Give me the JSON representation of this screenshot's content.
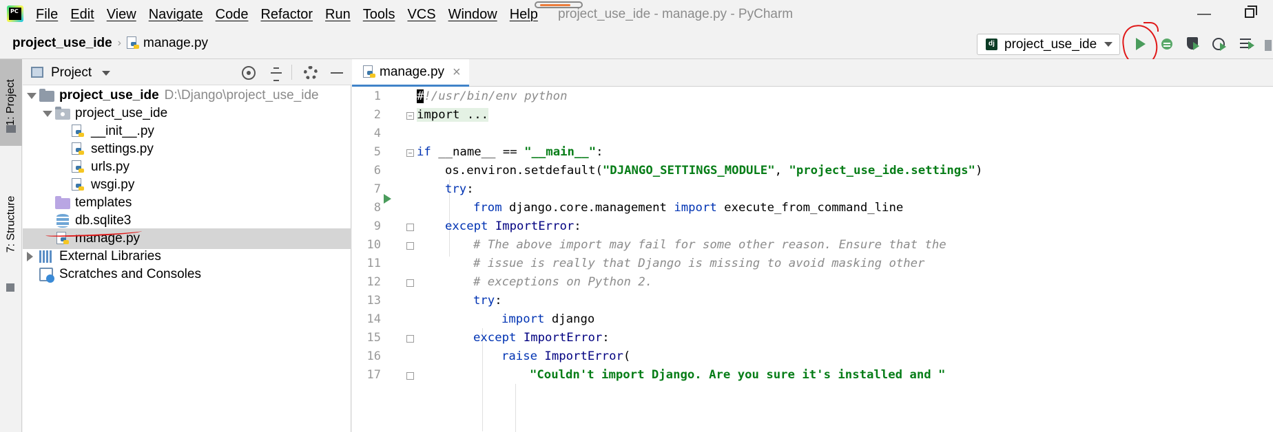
{
  "app": {
    "logo_text": "PC",
    "menu": [
      "File",
      "Edit",
      "View",
      "Navigate",
      "Code",
      "Refactor",
      "Run",
      "Tools",
      "VCS",
      "Window",
      "Help"
    ],
    "window_title": "project_use_ide - manage.py - PyCharm"
  },
  "navbar": {
    "project": "project_use_ide",
    "file": "manage.py",
    "run_config": "project_use_ide",
    "run_config_icon": "dj"
  },
  "tool_strip": {
    "project_tab": "1: Project",
    "structure_tab": "7: Structure"
  },
  "project_panel": {
    "title": "Project",
    "tree": [
      {
        "label": "project_use_ide",
        "hint": "D:\\Django\\project_use_ide"
      },
      {
        "label": "project_use_ide"
      },
      {
        "label": "__init__.py"
      },
      {
        "label": "settings.py"
      },
      {
        "label": "urls.py"
      },
      {
        "label": "wsgi.py"
      },
      {
        "label": "templates"
      },
      {
        "label": "db.sqlite3"
      },
      {
        "label": "manage.py"
      },
      {
        "label": "External Libraries"
      },
      {
        "label": "Scratches and Consoles"
      }
    ]
  },
  "editor": {
    "tab_label": "manage.py",
    "line_numbers": [
      "1",
      "2",
      "4",
      "5",
      "6",
      "7",
      "8",
      "9",
      "10",
      "11",
      "12",
      "13",
      "14",
      "15",
      "16",
      "17"
    ],
    "code": {
      "l1_cursor": "#",
      "l1_rest": "!/usr/bin/env python",
      "l2": "import ...",
      "l5_kw": "if",
      "l5_mid": " __name__ == ",
      "l5_str": "\"__main__\"",
      "l5_end": ":",
      "l6_a": "os.environ.setdefault(",
      "l6_s1": "\"DJANGO_SETTINGS_MODULE\"",
      "l6_b": ", ",
      "l6_s2": "\"project_use_ide.settings\"",
      "l6_c": ")",
      "l7_kw": "try",
      "l7_end": ":",
      "l8_kw1": "from",
      "l8_mod": " django.core.management ",
      "l8_kw2": "import",
      "l8_name": " execute_from_command_line",
      "l9_kw": "except",
      "l9_cls": " ImportError",
      "l9_end": ":",
      "l10": "# The above import may fail for some other reason. Ensure that the",
      "l11": "# issue is really that Django is missing to avoid masking other",
      "l12": "# exceptions on Python 2.",
      "l13_kw": "try",
      "l13_end": ":",
      "l14_kw": "import",
      "l14_mod": " django",
      "l15_kw": "except",
      "l15_cls": " ImportError",
      "l15_end": ":",
      "l16_kw": "raise",
      "l16_cls": " ImportError",
      "l16_end": "(",
      "l17_str": "\"Couldn't import Django. Are you sure it's installed and \""
    }
  },
  "colors": {
    "keyword": "#0033b3",
    "string": "#067d17",
    "comment": "#8c8c8c",
    "run_green": "#4a9c5c",
    "annotation_red": "#e01818",
    "selection": "#d5d5d5"
  }
}
